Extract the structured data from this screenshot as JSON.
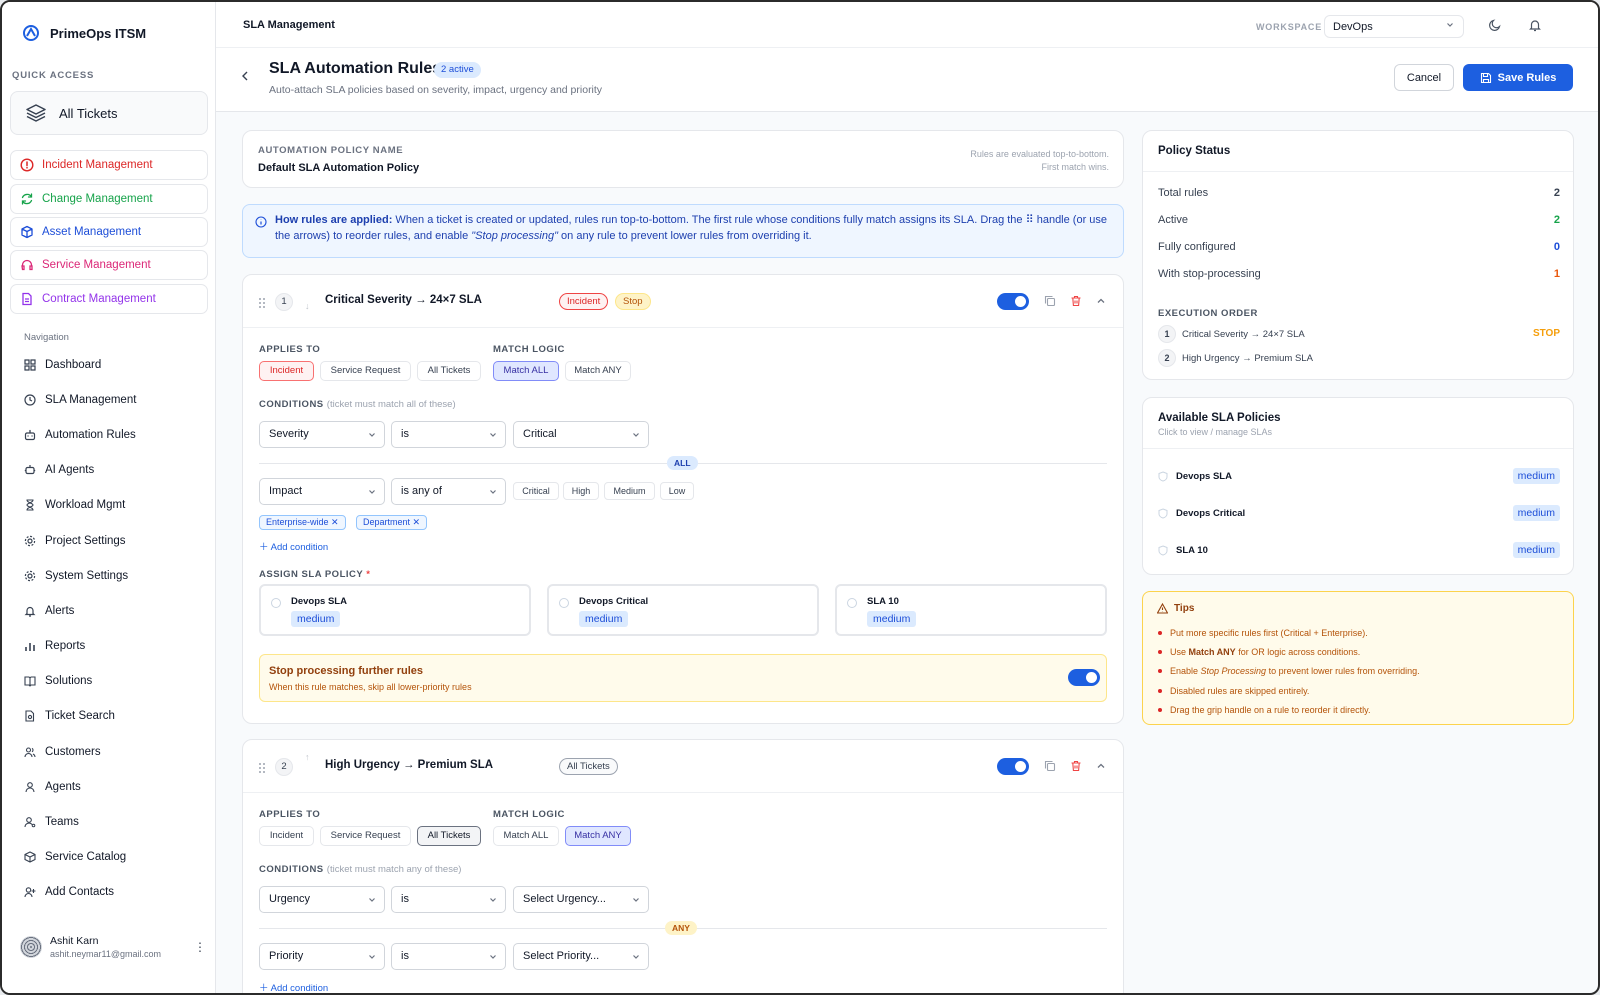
{
  "sidebar": {
    "brand": "PrimeOps ITSM",
    "quick_access_label": "QUICK ACCESS",
    "all_tickets": "All Tickets",
    "modules": [
      {
        "label": "Incident Management",
        "color": "#dc2626"
      },
      {
        "label": "Change Management",
        "color": "#16a34a"
      },
      {
        "label": "Asset Management",
        "color": "#1d4ed8"
      },
      {
        "label": "Service Management",
        "color": "#db2777"
      },
      {
        "label": "Contract Management",
        "color": "#9333ea"
      }
    ],
    "nav_label": "Navigation",
    "nav_items": [
      {
        "label": "Dashboard",
        "icon": "grid-icon"
      },
      {
        "label": "SLA Management",
        "icon": "clock-icon"
      },
      {
        "label": "Automation Rules",
        "icon": "bot-icon"
      },
      {
        "label": "AI Agents",
        "icon": "robot-icon"
      },
      {
        "label": "Workload Mgmt",
        "icon": "hourglass-icon"
      },
      {
        "label": "Project Settings",
        "icon": "gear-icon"
      },
      {
        "label": "System Settings",
        "icon": "gear-icon"
      },
      {
        "label": "Alerts",
        "icon": "bell-icon"
      },
      {
        "label": "Reports",
        "icon": "bar-chart-icon"
      },
      {
        "label": "Solutions",
        "icon": "book-icon"
      },
      {
        "label": "Ticket Search",
        "icon": "file-search-icon"
      },
      {
        "label": "Customers",
        "icon": "users-icon"
      },
      {
        "label": "Agents",
        "icon": "user-icon"
      },
      {
        "label": "Teams",
        "icon": "user-gear-icon"
      },
      {
        "label": "Service Catalog",
        "icon": "package-icon"
      },
      {
        "label": "Add Contacts",
        "icon": "user-plus-icon"
      }
    ],
    "user": {
      "name": "Ashit Karn",
      "email": "ashit.neymar11@gmail.com"
    }
  },
  "topbar": {
    "breadcrumb": "SLA Management",
    "workspace_label": "WORKSPACE",
    "workspace_value": "DevOps"
  },
  "header": {
    "title": "SLA Automation Rules",
    "badge": "2 active",
    "subtitle": "Auto-attach SLA policies based on severity, impact, urgency and priority",
    "cancel": "Cancel",
    "save": "Save Rules"
  },
  "policy": {
    "label": "AUTOMATION POLICY NAME",
    "name": "Default SLA Automation Policy",
    "hint_line1": "Rules are evaluated top-to-bottom.",
    "hint_line2": "First match wins."
  },
  "info": {
    "bold": "How rules are applied:",
    "text1": " When a ticket is created or updated, rules run top-to-bottom. The first rule whose conditions fully match assigns its SLA. Drag the ",
    "text2": " handle (or use the arrows) to reorder rules, and enable ",
    "italic": "\"Stop processing\"",
    "text3": " on any rule to prevent lower rules from overriding it."
  },
  "rules": [
    {
      "number": "1",
      "title": "Critical Severity → 24×7 SLA",
      "tags": [
        "Incident",
        "Stop"
      ],
      "applies_label": "APPLIES TO",
      "applies": [
        "Incident",
        "Service Request",
        "All Tickets"
      ],
      "logic_label": "MATCH LOGIC",
      "logic": [
        "Match ALL",
        "Match ANY"
      ],
      "conditions_label": "CONDITIONS",
      "conditions_hint": "(ticket must match all of these)",
      "c1": {
        "field": "Severity",
        "op": "is",
        "value": "Critical"
      },
      "joiner": "ALL",
      "c2": {
        "field": "Impact",
        "op": "is any of",
        "options": [
          "Critical",
          "High",
          "Medium",
          "Low"
        ],
        "chips": [
          "Enterprise-wide",
          "Department"
        ]
      },
      "add_condition": "Add condition",
      "assign_label": "ASSIGN SLA POLICY",
      "policies": [
        {
          "name": "Devops SLA",
          "level": "medium"
        },
        {
          "name": "Devops Critical",
          "level": "medium"
        },
        {
          "name": "SLA 10",
          "level": "medium"
        }
      ],
      "stop_title": "Stop processing further rules",
      "stop_sub": "When this rule matches, skip all lower-priority rules"
    },
    {
      "number": "2",
      "title": "High Urgency → Premium SLA",
      "tags": [
        "All Tickets"
      ],
      "applies_label": "APPLIES TO",
      "applies": [
        "Incident",
        "Service Request",
        "All Tickets"
      ],
      "logic_label": "MATCH LOGIC",
      "logic": [
        "Match ALL",
        "Match ANY"
      ],
      "conditions_label": "CONDITIONS",
      "conditions_hint": "(ticket must match any of these)",
      "c1": {
        "field": "Urgency",
        "op": "is",
        "value": "Select Urgency..."
      },
      "joiner": "ANY",
      "c2": {
        "field": "Priority",
        "op": "is",
        "value": "Select Priority..."
      },
      "add_condition": "Add condition"
    }
  ],
  "status": {
    "title": "Policy Status",
    "rows": [
      {
        "label": "Total rules",
        "value": "2",
        "color": "#111827"
      },
      {
        "label": "Active",
        "value": "2",
        "color": "#16a34a"
      },
      {
        "label": "Fully configured",
        "value": "0",
        "color": "#1d4ed8"
      },
      {
        "label": "With stop-processing",
        "value": "1",
        "color": "#ea580c"
      }
    ],
    "exec_label": "EXECUTION ORDER",
    "exec": [
      {
        "n": "1",
        "label": "Critical Severity → 24×7 SLA",
        "flag": "STOP"
      },
      {
        "n": "2",
        "label": "High Urgency → Premium SLA",
        "flag": ""
      }
    ]
  },
  "available": {
    "title": "Available SLA Policies",
    "subtitle": "Click to view / manage SLAs",
    "items": [
      {
        "name": "Devops SLA",
        "level": "medium"
      },
      {
        "name": "Devops Critical",
        "level": "medium"
      },
      {
        "name": "SLA 10",
        "level": "medium"
      }
    ]
  },
  "tips": {
    "title": "Tips",
    "items": [
      {
        "a": "Put more specific rules first (Critical + Enterprise).",
        "b": "",
        "c": ""
      },
      {
        "a": "Use ",
        "b": "Match ANY",
        "c": " for OR logic across conditions."
      },
      {
        "a": "Enable ",
        "b": "Stop Processing",
        "c": " to prevent lower rules from overriding."
      },
      {
        "a": "Disabled rules are skipped entirely.",
        "b": "",
        "c": ""
      },
      {
        "a": "Drag the grip handle on a rule to reorder it directly.",
        "b": "",
        "c": ""
      }
    ]
  }
}
